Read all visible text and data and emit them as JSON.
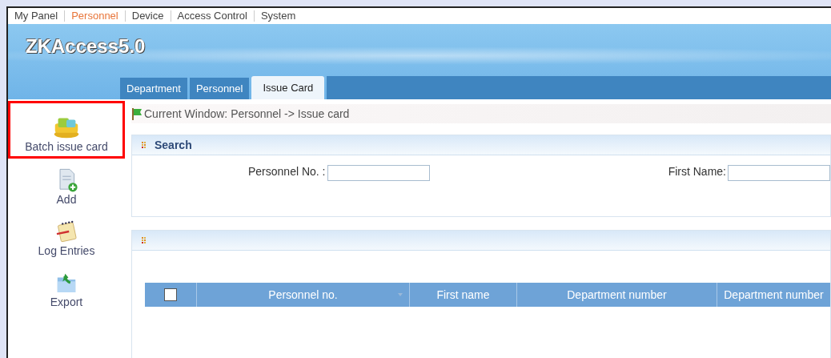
{
  "top_menu": [
    {
      "label": "My Panel",
      "selected": false
    },
    {
      "label": "Personnel",
      "selected": true
    },
    {
      "label": "Device",
      "selected": false
    },
    {
      "label": "Access Control",
      "selected": false
    },
    {
      "label": "System",
      "selected": false
    }
  ],
  "logo": "ZKAccess5.0",
  "tabs": [
    {
      "label": "Department",
      "selected": false
    },
    {
      "label": "Personnel",
      "selected": false
    },
    {
      "label": "Issue Card",
      "selected": true
    }
  ],
  "sidebar": {
    "items": [
      {
        "label": "Batch issue card",
        "kind": "cards",
        "highlighted": true
      },
      {
        "label": "Add",
        "kind": "add",
        "highlighted": false
      },
      {
        "label": "Log Entries",
        "kind": "log",
        "highlighted": false
      },
      {
        "label": "Export",
        "kind": "export",
        "highlighted": false
      }
    ]
  },
  "breadcrumb": "Current Window: Personnel -> Issue card",
  "search": {
    "title": "Search",
    "fields": [
      {
        "label": "Personnel No. :"
      },
      {
        "label": "First Name:"
      }
    ]
  },
  "table": {
    "select_all": {
      "checked": false
    },
    "columns": [
      {
        "label": "Personnel no.",
        "sortable": true
      },
      {
        "label": "First name",
        "sortable": false
      },
      {
        "label": "Department number",
        "sortable": false
      },
      {
        "label": "Department number",
        "sortable": false
      }
    ]
  }
}
